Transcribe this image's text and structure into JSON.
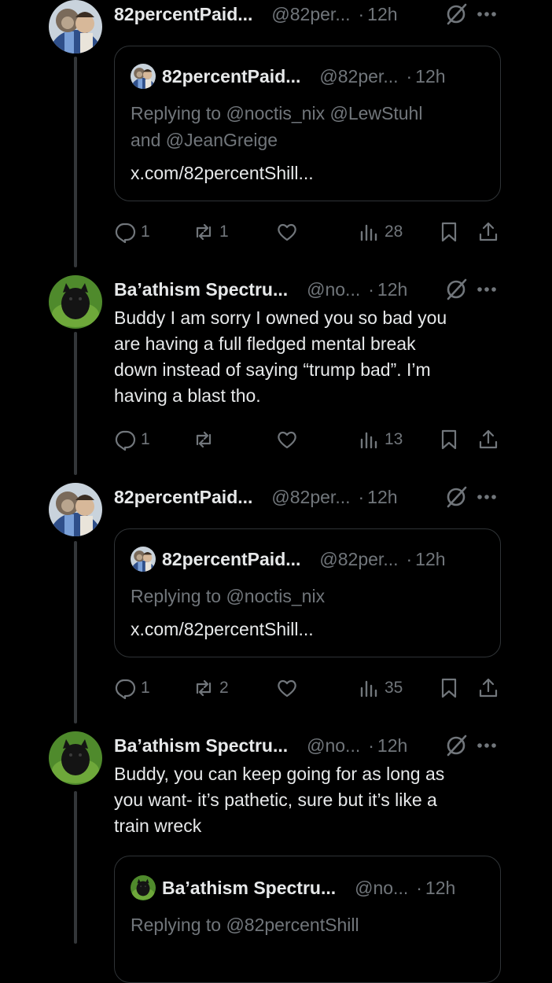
{
  "colors": {
    "background": "#000000",
    "text": "#e7e9ea",
    "muted": "#71767b",
    "border": "#2f3336"
  },
  "tweets": [
    {
      "name": "82percentPaid...",
      "handle": "@82per...",
      "dot": "·",
      "time": "12h",
      "quote": {
        "name": "82percentPaid...",
        "handle": "@82per...",
        "dot": "·",
        "time": "12h",
        "reply_line1": "Replying to @noctis_nix @LewStuhl",
        "reply_line2": "and @JeanGreige",
        "link": "x.com/82percentShill..."
      },
      "stats": {
        "replies": "1",
        "reposts": "1",
        "likes": "",
        "views": "28"
      }
    },
    {
      "name": "Ba’athism Spectru...",
      "handle": "@no...",
      "dot": "·",
      "time": "12h",
      "lines": [
        "Buddy I am sorry I owned you so bad you",
        "are having a full fledged mental break",
        "down instead of saying “trump bad”. I’m",
        "having a blast tho."
      ],
      "stats": {
        "replies": "1",
        "reposts": "",
        "likes": "",
        "views": "13"
      }
    },
    {
      "name": "82percentPaid...",
      "handle": "@82per...",
      "dot": "·",
      "time": "12h",
      "quote": {
        "name": "82percentPaid...",
        "handle": "@82per...",
        "dot": "·",
        "time": "12h",
        "reply_line1": "Replying to @noctis_nix",
        "link": "x.com/82percentShill..."
      },
      "stats": {
        "replies": "1",
        "reposts": "2",
        "likes": "",
        "views": "35"
      }
    },
    {
      "name": "Ba’athism Spectru...",
      "handle": "@no...",
      "dot": "·",
      "time": "12h",
      "lines": [
        "Buddy, you can keep going for as long as",
        "you want- it’s pathetic, sure but it’s like a",
        "train wreck"
      ],
      "quote": {
        "name": "Ba’athism Spectru...",
        "handle": "@no...",
        "dot": "·",
        "time": "12h",
        "reply_line1": "Replying to @82percentShill"
      }
    }
  ],
  "icons": [
    "grok-icon",
    "more-icon",
    "reply-icon",
    "repost-icon",
    "like-icon",
    "views-icon",
    "bookmark-icon",
    "share-icon"
  ]
}
